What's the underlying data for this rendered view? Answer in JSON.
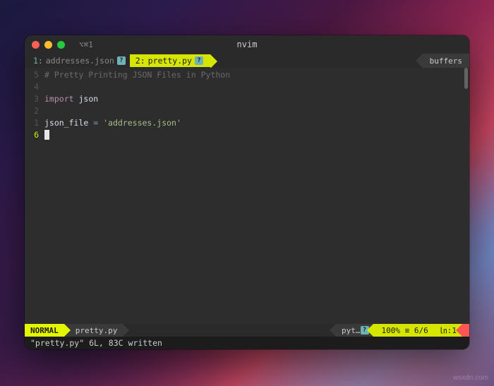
{
  "window": {
    "title": "nvim",
    "tab_indicator": "⌥⌘1"
  },
  "bufferline": {
    "buffers": [
      {
        "index": "1:",
        "name": "addresses.json",
        "modified_badge": "?"
      },
      {
        "index": "2:",
        "name": "pretty.py",
        "modified_badge": "?"
      }
    ],
    "right_label": "buffers"
  },
  "gutter": {
    "lines": [
      "5",
      "4",
      "3",
      "2",
      "1",
      "6"
    ]
  },
  "code": {
    "l1_comment": "# Pretty Printing JSON Files in Python",
    "l2": "",
    "l3_kw": "import",
    "l3_mod": " json",
    "l4": "",
    "l5_var": "json_file ",
    "l5_op": "=",
    "l5_str": " 'addresses.json'"
  },
  "status": {
    "mode": "NORMAL",
    "filename": "pretty.py",
    "filetype": "pyt…",
    "filetype_badge": "?",
    "percent": "100%",
    "sep": "≡",
    "lines": "6/6",
    "col_icon": "㏑:",
    "col": "1"
  },
  "cmdline": "\"pretty.py\" 6L, 83C written",
  "watermark": "wsxdn.com"
}
